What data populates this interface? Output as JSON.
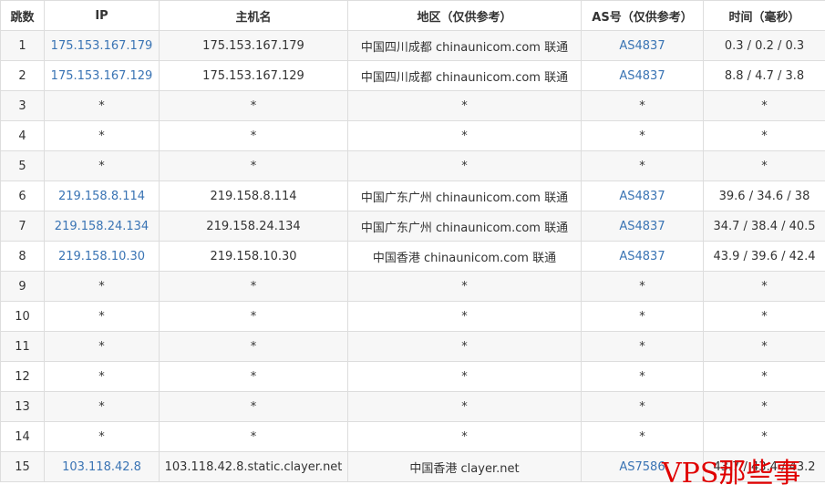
{
  "table": {
    "headers": [
      "跳数",
      "IP",
      "主机名",
      "地区（仅供参考）",
      "AS号（仅供参考）",
      "时间（毫秒）"
    ],
    "rows": [
      {
        "hop": "1",
        "ip": "175.153.167.179",
        "host": "175.153.167.179",
        "region": "中国四川成都 chinaunicom.com 联通",
        "as": "AS4837",
        "time": "0.3 / 0.2 / 0.3"
      },
      {
        "hop": "2",
        "ip": "175.153.167.129",
        "host": "175.153.167.129",
        "region": "中国四川成都 chinaunicom.com 联通",
        "as": "AS4837",
        "time": "8.8 / 4.7 / 3.8"
      },
      {
        "hop": "3",
        "ip": "*",
        "host": "*",
        "region": "*",
        "as": "*",
        "time": "*"
      },
      {
        "hop": "4",
        "ip": "*",
        "host": "*",
        "region": "*",
        "as": "*",
        "time": "*"
      },
      {
        "hop": "5",
        "ip": "*",
        "host": "*",
        "region": "*",
        "as": "*",
        "time": "*"
      },
      {
        "hop": "6",
        "ip": "219.158.8.114",
        "host": "219.158.8.114",
        "region": "中国广东广州 chinaunicom.com 联通",
        "as": "AS4837",
        "time": "39.6 / 34.6 / 38"
      },
      {
        "hop": "7",
        "ip": "219.158.24.134",
        "host": "219.158.24.134",
        "region": "中国广东广州 chinaunicom.com 联通",
        "as": "AS4837",
        "time": "34.7 / 38.4 / 40.5"
      },
      {
        "hop": "8",
        "ip": "219.158.10.30",
        "host": "219.158.10.30",
        "region": "中国香港 chinaunicom.com 联通",
        "as": "AS4837",
        "time": "43.9 / 39.6 / 42.4"
      },
      {
        "hop": "9",
        "ip": "*",
        "host": "*",
        "region": "*",
        "as": "*",
        "time": "*"
      },
      {
        "hop": "10",
        "ip": "*",
        "host": "*",
        "region": "*",
        "as": "*",
        "time": "*"
      },
      {
        "hop": "11",
        "ip": "*",
        "host": "*",
        "region": "*",
        "as": "*",
        "time": "*"
      },
      {
        "hop": "12",
        "ip": "*",
        "host": "*",
        "region": "*",
        "as": "*",
        "time": "*"
      },
      {
        "hop": "13",
        "ip": "*",
        "host": "*",
        "region": "*",
        "as": "*",
        "time": "*"
      },
      {
        "hop": "14",
        "ip": "*",
        "host": "*",
        "region": "*",
        "as": "*",
        "time": "*"
      },
      {
        "hop": "15",
        "ip": "103.118.42.8",
        "host": "103.118.42.8.static.clayer.net",
        "region": "中国香港 clayer.net",
        "as": "AS7586",
        "time": "43.7 / 43.4 / 43.2"
      }
    ]
  },
  "watermark": "VPS那些事",
  "colors": {
    "link": "#3a74b4",
    "border": "#dddddd",
    "stripe": "#f7f7f7",
    "watermark": "#e00000"
  }
}
